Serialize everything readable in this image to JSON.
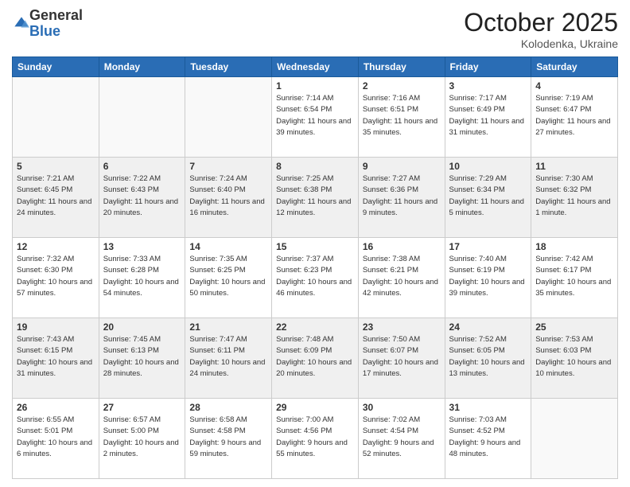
{
  "header": {
    "logo_general": "General",
    "logo_blue": "Blue",
    "month_title": "October 2025",
    "location": "Kolodenka, Ukraine"
  },
  "days_of_week": [
    "Sunday",
    "Monday",
    "Tuesday",
    "Wednesday",
    "Thursday",
    "Friday",
    "Saturday"
  ],
  "weeks": [
    {
      "shaded": false,
      "days": [
        {
          "date": "",
          "info": ""
        },
        {
          "date": "",
          "info": ""
        },
        {
          "date": "",
          "info": ""
        },
        {
          "date": "1",
          "info": "Sunrise: 7:14 AM\nSunset: 6:54 PM\nDaylight: 11 hours and 39 minutes."
        },
        {
          "date": "2",
          "info": "Sunrise: 7:16 AM\nSunset: 6:51 PM\nDaylight: 11 hours and 35 minutes."
        },
        {
          "date": "3",
          "info": "Sunrise: 7:17 AM\nSunset: 6:49 PM\nDaylight: 11 hours and 31 minutes."
        },
        {
          "date": "4",
          "info": "Sunrise: 7:19 AM\nSunset: 6:47 PM\nDaylight: 11 hours and 27 minutes."
        }
      ]
    },
    {
      "shaded": true,
      "days": [
        {
          "date": "5",
          "info": "Sunrise: 7:21 AM\nSunset: 6:45 PM\nDaylight: 11 hours and 24 minutes."
        },
        {
          "date": "6",
          "info": "Sunrise: 7:22 AM\nSunset: 6:43 PM\nDaylight: 11 hours and 20 minutes."
        },
        {
          "date": "7",
          "info": "Sunrise: 7:24 AM\nSunset: 6:40 PM\nDaylight: 11 hours and 16 minutes."
        },
        {
          "date": "8",
          "info": "Sunrise: 7:25 AM\nSunset: 6:38 PM\nDaylight: 11 hours and 12 minutes."
        },
        {
          "date": "9",
          "info": "Sunrise: 7:27 AM\nSunset: 6:36 PM\nDaylight: 11 hours and 9 minutes."
        },
        {
          "date": "10",
          "info": "Sunrise: 7:29 AM\nSunset: 6:34 PM\nDaylight: 11 hours and 5 minutes."
        },
        {
          "date": "11",
          "info": "Sunrise: 7:30 AM\nSunset: 6:32 PM\nDaylight: 11 hours and 1 minute."
        }
      ]
    },
    {
      "shaded": false,
      "days": [
        {
          "date": "12",
          "info": "Sunrise: 7:32 AM\nSunset: 6:30 PM\nDaylight: 10 hours and 57 minutes."
        },
        {
          "date": "13",
          "info": "Sunrise: 7:33 AM\nSunset: 6:28 PM\nDaylight: 10 hours and 54 minutes."
        },
        {
          "date": "14",
          "info": "Sunrise: 7:35 AM\nSunset: 6:25 PM\nDaylight: 10 hours and 50 minutes."
        },
        {
          "date": "15",
          "info": "Sunrise: 7:37 AM\nSunset: 6:23 PM\nDaylight: 10 hours and 46 minutes."
        },
        {
          "date": "16",
          "info": "Sunrise: 7:38 AM\nSunset: 6:21 PM\nDaylight: 10 hours and 42 minutes."
        },
        {
          "date": "17",
          "info": "Sunrise: 7:40 AM\nSunset: 6:19 PM\nDaylight: 10 hours and 39 minutes."
        },
        {
          "date": "18",
          "info": "Sunrise: 7:42 AM\nSunset: 6:17 PM\nDaylight: 10 hours and 35 minutes."
        }
      ]
    },
    {
      "shaded": true,
      "days": [
        {
          "date": "19",
          "info": "Sunrise: 7:43 AM\nSunset: 6:15 PM\nDaylight: 10 hours and 31 minutes."
        },
        {
          "date": "20",
          "info": "Sunrise: 7:45 AM\nSunset: 6:13 PM\nDaylight: 10 hours and 28 minutes."
        },
        {
          "date": "21",
          "info": "Sunrise: 7:47 AM\nSunset: 6:11 PM\nDaylight: 10 hours and 24 minutes."
        },
        {
          "date": "22",
          "info": "Sunrise: 7:48 AM\nSunset: 6:09 PM\nDaylight: 10 hours and 20 minutes."
        },
        {
          "date": "23",
          "info": "Sunrise: 7:50 AM\nSunset: 6:07 PM\nDaylight: 10 hours and 17 minutes."
        },
        {
          "date": "24",
          "info": "Sunrise: 7:52 AM\nSunset: 6:05 PM\nDaylight: 10 hours and 13 minutes."
        },
        {
          "date": "25",
          "info": "Sunrise: 7:53 AM\nSunset: 6:03 PM\nDaylight: 10 hours and 10 minutes."
        }
      ]
    },
    {
      "shaded": false,
      "days": [
        {
          "date": "26",
          "info": "Sunrise: 6:55 AM\nSunset: 5:01 PM\nDaylight: 10 hours and 6 minutes."
        },
        {
          "date": "27",
          "info": "Sunrise: 6:57 AM\nSunset: 5:00 PM\nDaylight: 10 hours and 2 minutes."
        },
        {
          "date": "28",
          "info": "Sunrise: 6:58 AM\nSunset: 4:58 PM\nDaylight: 9 hours and 59 minutes."
        },
        {
          "date": "29",
          "info": "Sunrise: 7:00 AM\nSunset: 4:56 PM\nDaylight: 9 hours and 55 minutes."
        },
        {
          "date": "30",
          "info": "Sunrise: 7:02 AM\nSunset: 4:54 PM\nDaylight: 9 hours and 52 minutes."
        },
        {
          "date": "31",
          "info": "Sunrise: 7:03 AM\nSunset: 4:52 PM\nDaylight: 9 hours and 48 minutes."
        },
        {
          "date": "",
          "info": ""
        }
      ]
    }
  ]
}
